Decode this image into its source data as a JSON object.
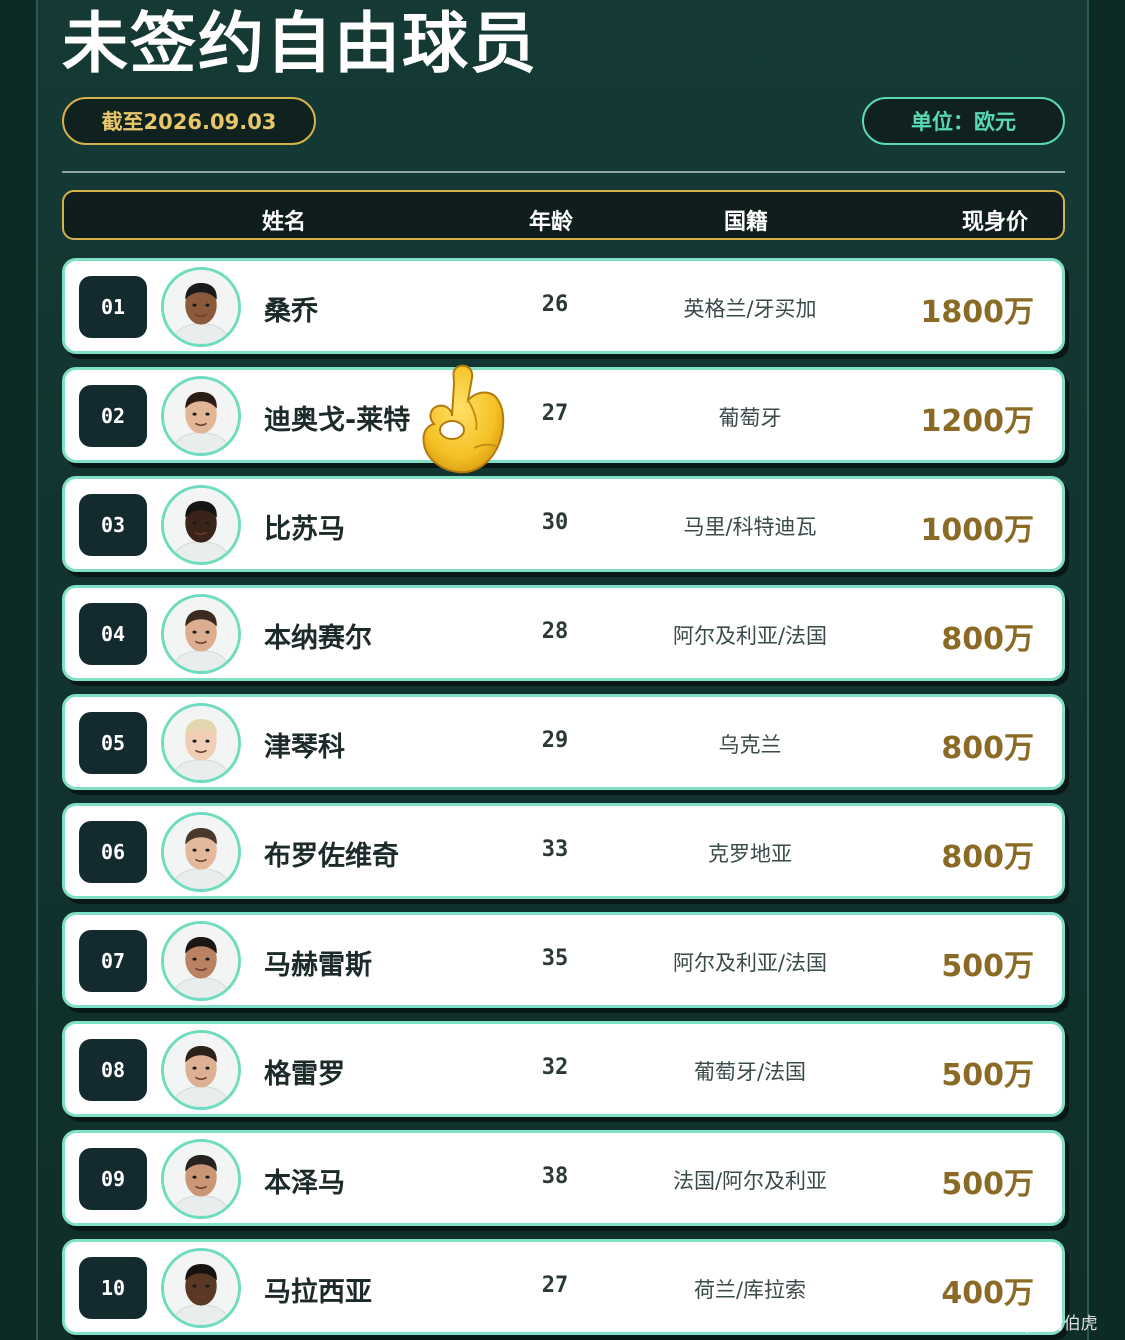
{
  "title": "未签约自由球员",
  "date_badge": "截至2026.09.03",
  "unit_badge": "单位：欧元",
  "header": {
    "name": "姓名",
    "age": "年龄",
    "nationality": "国籍",
    "value": "现身价"
  },
  "players": [
    {
      "rank": "01",
      "name": "桑乔",
      "age": "26",
      "nationality": "英格兰/牙买加",
      "value": "1800万",
      "skin": "#8a5a3b",
      "hair": "#1b1b1b"
    },
    {
      "rank": "02",
      "name": "迪奥戈-莱特",
      "age": "27",
      "nationality": "葡萄牙",
      "value": "1200万",
      "skin": "#e2b596",
      "hair": "#2a1d16"
    },
    {
      "rank": "03",
      "name": "比苏马",
      "age": "30",
      "nationality": "马里/科特迪瓦",
      "value": "1000万",
      "skin": "#3a2419",
      "hair": "#151515"
    },
    {
      "rank": "04",
      "name": "本纳赛尔",
      "age": "28",
      "nationality": "阿尔及利亚/法国",
      "value": "800万",
      "skin": "#dcae8f",
      "hair": "#3b2a20"
    },
    {
      "rank": "05",
      "name": "津琴科",
      "age": "29",
      "nationality": "乌克兰",
      "value": "800万",
      "skin": "#f0cdb5",
      "hair": "#e3d7b0"
    },
    {
      "rank": "06",
      "name": "布罗佐维奇",
      "age": "33",
      "nationality": "克罗地亚",
      "value": "800万",
      "skin": "#e4b99b",
      "hair": "#4a3a2e"
    },
    {
      "rank": "07",
      "name": "马赫雷斯",
      "age": "35",
      "nationality": "阿尔及利亚/法国",
      "value": "500万",
      "skin": "#b98262",
      "hair": "#1d1714"
    },
    {
      "rank": "08",
      "name": "格雷罗",
      "age": "32",
      "nationality": "葡萄牙/法国",
      "value": "500万",
      "skin": "#ddb093",
      "hair": "#2b201a"
    },
    {
      "rank": "09",
      "name": "本泽马",
      "age": "38",
      "nationality": "法国/阿尔及利亚",
      "value": "500万",
      "skin": "#c99676",
      "hair": "#262220"
    },
    {
      "rank": "10",
      "name": "马拉西亚",
      "age": "27",
      "nationality": "荷兰/库拉索",
      "value": "400万",
      "skin": "#5a3826",
      "hair": "#161210"
    }
  ],
  "colors": {
    "gold": "#d6b24a",
    "mint": "#59d9b5",
    "value_text": "#8b6a25",
    "background": "#0d2a26"
  },
  "watermark": "网易号 | K唐伯虎"
}
